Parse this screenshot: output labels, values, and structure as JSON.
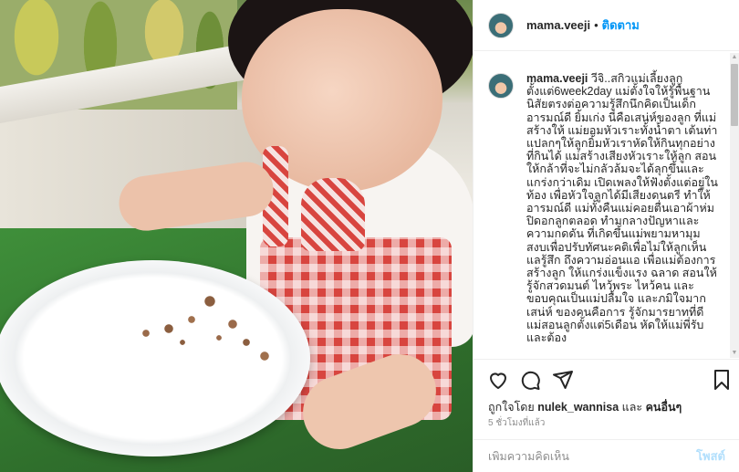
{
  "post": {
    "username": "mama.veeji",
    "separator": "•",
    "follow_label": "ติดตาม"
  },
  "caption": {
    "username": "mama.veeji",
    "text": "วีจิ..สกิวแม่เลี้ยงลูกตั้งแต่6week2day แม่ตั้งใจให้รู้พื้นฐานนิสัยตรงต่อความรู้สึกนึกคิดเป็นเด็กอารมณ์ดี ยิ้มเก่ง นี่คือเสน่ห์ของลูก ที่แม่สร้างให้ แม่ยอมหัวเราะทั้งน้ำตา เต้นท่าแปลกๆให้ลูกยิ้มหัวเราหัดให้กินทุกอย่างที่กินได้ แม่สร้างเสียงหัวเราะให้ลูก สอนให้กล้าที่จะไม่กลัวล้มจะได้ลุกขึ้นและแกร่งกว่าเดิม เปิดเพลงให้ฟังตั้งแต่อยู่ในท้อง เพื่อหัวใจลูกได้มีเสียงดนตรี ทำให้อารมณ์ดี แม่ทั้งคืนแม่คอยตื่นเอาผ้าห่มปิดอกลูกตลอด ทำมกลางปัญหาและความกดดัน ที่เกิดขึ้นแม่พยามหามุมสงบเพื่อปรับทัศนะคติเพื่อไม่ให้ลูกเห็นแลรู้สึก ถึงความอ่อนแอ เพื่อแม่ต้องการสร้างลูก ให้แกร่งแข็งแรง ฉลาด สอนให้รู้จักสวดมนต์ ไหว้พระ ไหว้คน และขอบคุณเป็นแม่ปลื้มใจ และภมิใจมาก เสน่ห์ ของคนคือการ รู้จักมารยาทที่ดี แม่สอนลูกตั้งแต่5เดือน หัดให้แม่พี่รับ และต้อง"
  },
  "likes": {
    "prefix": "ถูกใจโดย",
    "user": "nulek_wannisa",
    "conjunction": "และ",
    "others": "คนอื่นๆ"
  },
  "timestamp": "5 ชั่วโมงที่แล้ว",
  "comment": {
    "placeholder": "เพิ่มความคิดเห็น",
    "post_label": "โพสต์"
  }
}
